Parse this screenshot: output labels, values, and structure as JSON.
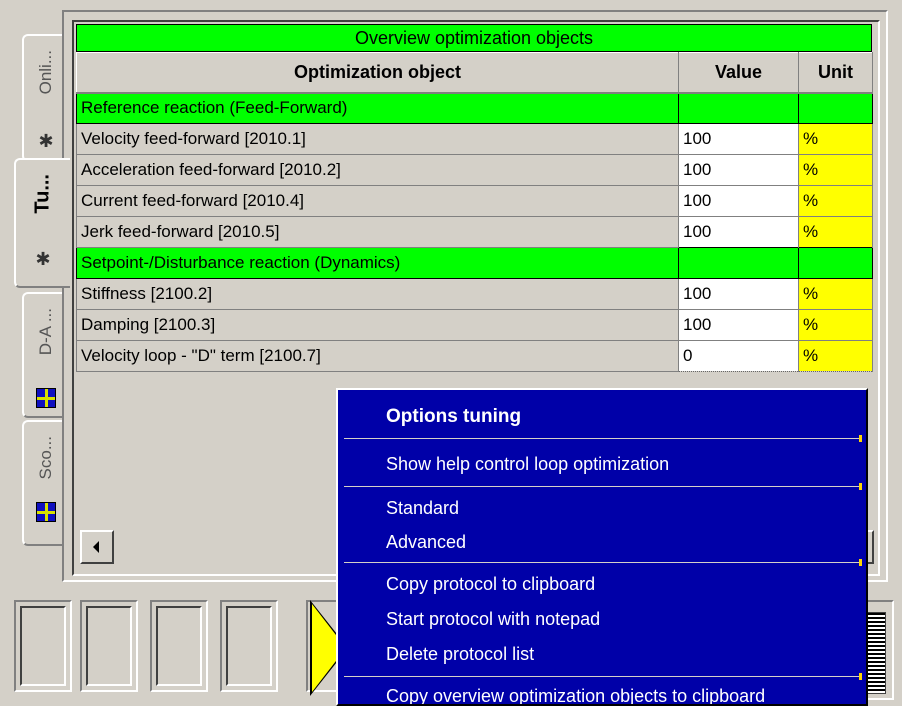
{
  "tabs": [
    {
      "label": "Onli...",
      "icon": "gear-icon",
      "active": false
    },
    {
      "label": "Tu...",
      "icon": "gear-icon",
      "active": true
    },
    {
      "label": "D-A ...",
      "icon": "grid-icon",
      "active": false
    },
    {
      "label": "Sco...",
      "icon": "grid-icon",
      "active": false
    }
  ],
  "grid": {
    "title": "Overview optimization objects",
    "headers": {
      "object": "Optimization object",
      "value": "Value",
      "unit": "Unit"
    },
    "rows": [
      {
        "type": "section",
        "name": "Reference reaction (Feed-Forward)"
      },
      {
        "type": "item",
        "name": "Velocity feed-forward [2010.1]",
        "value": "100",
        "unit": "%"
      },
      {
        "type": "item",
        "name": "Acceleration feed-forward [2010.2]",
        "value": "100",
        "unit": "%"
      },
      {
        "type": "item",
        "name": "Current feed-forward [2010.4]",
        "value": "100",
        "unit": "%"
      },
      {
        "type": "item",
        "name": "Jerk feed-forward [2010.5]",
        "value": "100",
        "unit": "%"
      },
      {
        "type": "section",
        "name": "Setpoint-/Disturbance reaction (Dynamics)"
      },
      {
        "type": "item",
        "name": "Stiffness [2100.2]",
        "value": "100",
        "unit": "%"
      },
      {
        "type": "item",
        "name": "Damping [2100.3]",
        "value": "100",
        "unit": "%"
      },
      {
        "type": "item",
        "name": "Velocity loop - \"D\" term [2100.7]",
        "value": "0",
        "unit": "%"
      }
    ]
  },
  "menu": {
    "header": "Options tuning",
    "items": [
      "Show help control loop optimization",
      "Standard",
      "Advanced",
      "Copy protocol to clipboard",
      "Start protocol with notepad",
      "Delete protocol list",
      "Copy overview optimization objects to clipboard"
    ]
  },
  "colors": {
    "section_green": "#00ff00",
    "unit_yellow": "#ffff00",
    "menu_blue": "#0000a8"
  }
}
